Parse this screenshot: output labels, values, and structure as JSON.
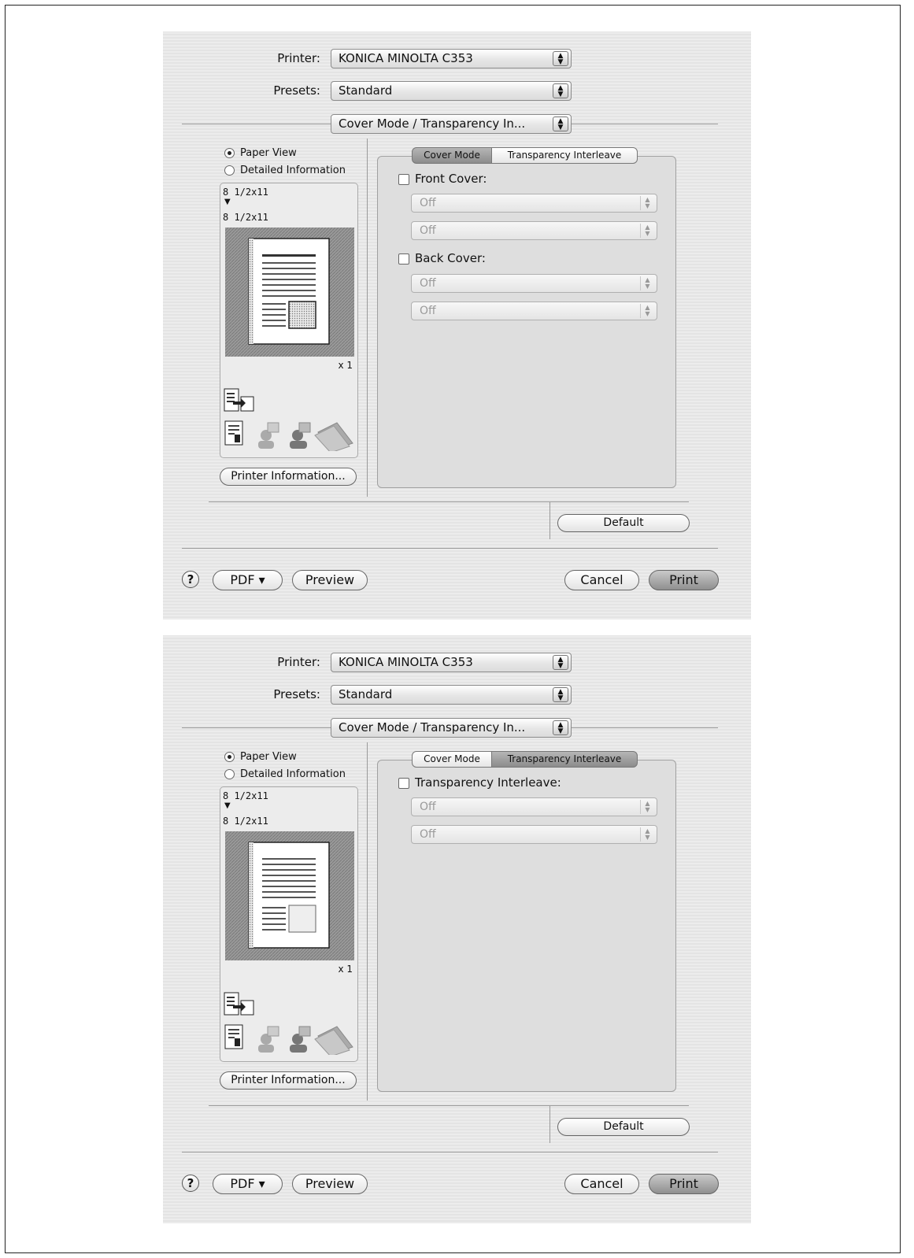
{
  "dialogs": [
    {
      "printer_label": "Printer:",
      "printer_value": "KONICA MINOLTA C353",
      "presets_label": "Presets:",
      "presets_value": "Standard",
      "section_value": "Cover Mode / Transparency In...",
      "view_paper": "Paper View",
      "view_detail": "Detailed Information",
      "paper_from": "8 1/2x11",
      "paper_arrow": "▼",
      "paper_to": "8 1/2x11",
      "copies": "x 1",
      "printer_info": "Printer Information...",
      "tab_cover": "Cover Mode",
      "tab_transparency": "Transparency Interleave",
      "selected_tab": "cover",
      "front_cover_label": "Front Cover:",
      "front_cover_1": "Off",
      "front_cover_2": "Off",
      "back_cover_label": "Back Cover:",
      "back_cover_1": "Off",
      "back_cover_2": "Off",
      "default": "Default",
      "help": "?",
      "pdf": "PDF ▾",
      "preview": "Preview",
      "cancel": "Cancel",
      "print": "Print"
    },
    {
      "printer_label": "Printer:",
      "printer_value": "KONICA MINOLTA C353",
      "presets_label": "Presets:",
      "presets_value": "Standard",
      "section_value": "Cover Mode / Transparency In...",
      "view_paper": "Paper View",
      "view_detail": "Detailed Information",
      "paper_from": "8 1/2x11",
      "paper_arrow": "▼",
      "paper_to": "8 1/2x11",
      "copies": "x 1",
      "printer_info": "Printer Information...",
      "tab_cover": "Cover Mode",
      "tab_transparency": "Transparency Interleave",
      "selected_tab": "transparency",
      "transparency_label": "Transparency Interleave:",
      "transparency_1": "Off",
      "transparency_2": "Off",
      "default": "Default",
      "help": "?",
      "pdf": "PDF ▾",
      "preview": "Preview",
      "cancel": "Cancel",
      "print": "Print"
    }
  ]
}
